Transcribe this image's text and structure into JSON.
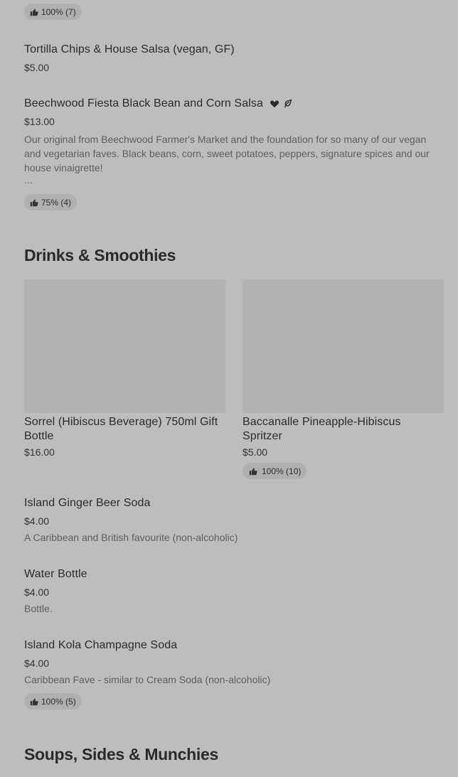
{
  "top_badge": {
    "label": "100% (7)"
  },
  "items_top": [
    {
      "title": "Tortilla Chips & House Salsa (vegan, GF)",
      "price": "$5.00"
    },
    {
      "title": "Beechwood Fiesta Black Bean and Corn Salsa",
      "price": "$13.00",
      "description": "Our original from Beechwood Farmer's Market and the foundation for so many of our vegan and vegetarian faves. Black beans, corn, sweet potatoes, peppers, signature spices and our house vinaigrette!",
      "ellipsis": "...",
      "badge": "75% (4)"
    }
  ],
  "drinks": {
    "title": "Drinks & Smoothies",
    "cards": [
      {
        "title": "Sorrel (Hibiscus Beverage) 750ml Gift Bottle",
        "price": "$16.00"
      },
      {
        "title": "Baccanalle Pineapple-Hibiscus Spritzer",
        "price": "$5.00",
        "badge": "100% (10)"
      }
    ],
    "items": [
      {
        "title": "Island Ginger Beer Soda",
        "price": "$4.00",
        "description": "A Caribbean and British favourite (non-alcoholic)"
      },
      {
        "title": "Water Bottle",
        "price": "$4.00",
        "description": "Bottle."
      },
      {
        "title": "Island Kola Champagne Soda",
        "price": "$4.00",
        "description": "Caribbean Fave - similar to Cream Soda (non-alcoholic)",
        "badge": "100% (5)"
      }
    ]
  },
  "soups": {
    "title": "Soups, Sides & Munchies"
  }
}
